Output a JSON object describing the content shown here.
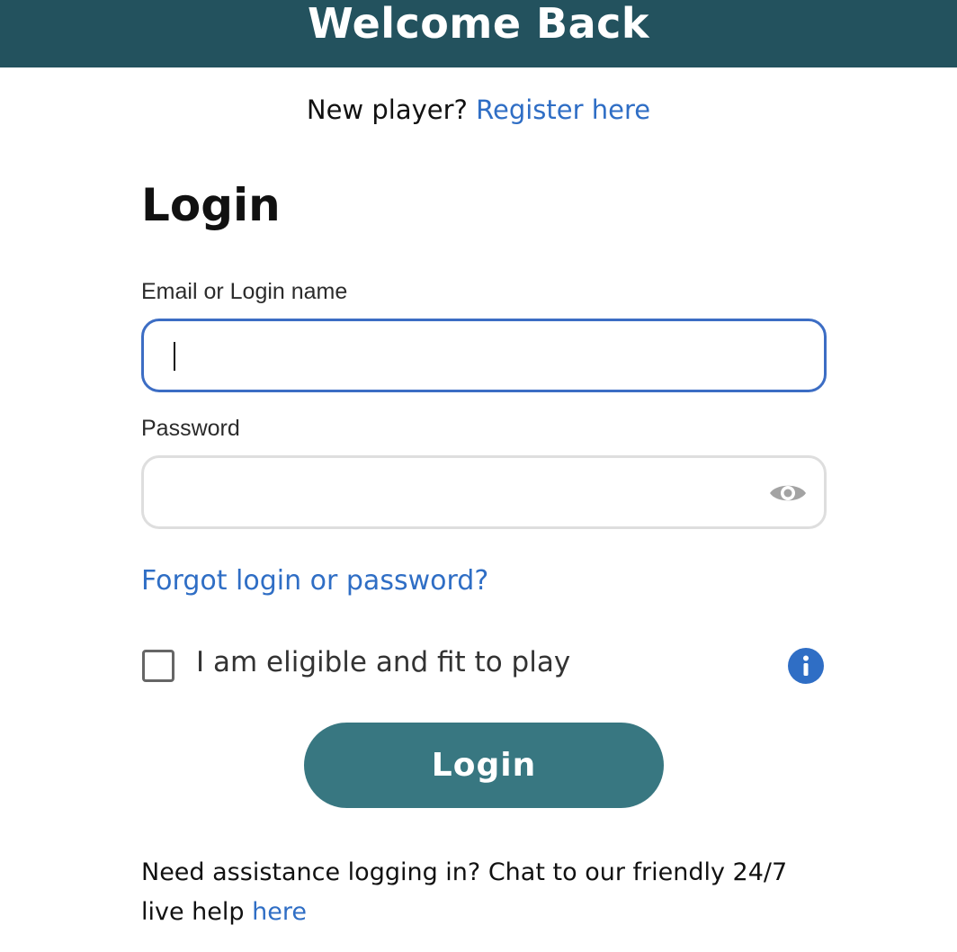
{
  "header": {
    "title": "Welcome Back",
    "background_color": "#23525e"
  },
  "register": {
    "prompt": "New player?",
    "link_label": "Register here"
  },
  "form": {
    "heading": "Login",
    "email": {
      "label": "Email or Login name",
      "value": "",
      "focused": true
    },
    "password": {
      "label": "Password",
      "value": "",
      "toggle_icon": "eye-icon"
    },
    "forgot_link": "Forgot login or password?",
    "eligibility": {
      "label": "I am eligible and fit to play",
      "checked": false,
      "info_icon": "info-icon"
    },
    "submit_label": "Login"
  },
  "assistance": {
    "text": "Need assistance logging in? Chat to our friendly 24/7 live help",
    "link_label": "here"
  },
  "colors": {
    "link": "#2f6ec5",
    "button": "#387781",
    "focus_border": "#3c6dc4",
    "info_icon": "#2f6ec5"
  }
}
